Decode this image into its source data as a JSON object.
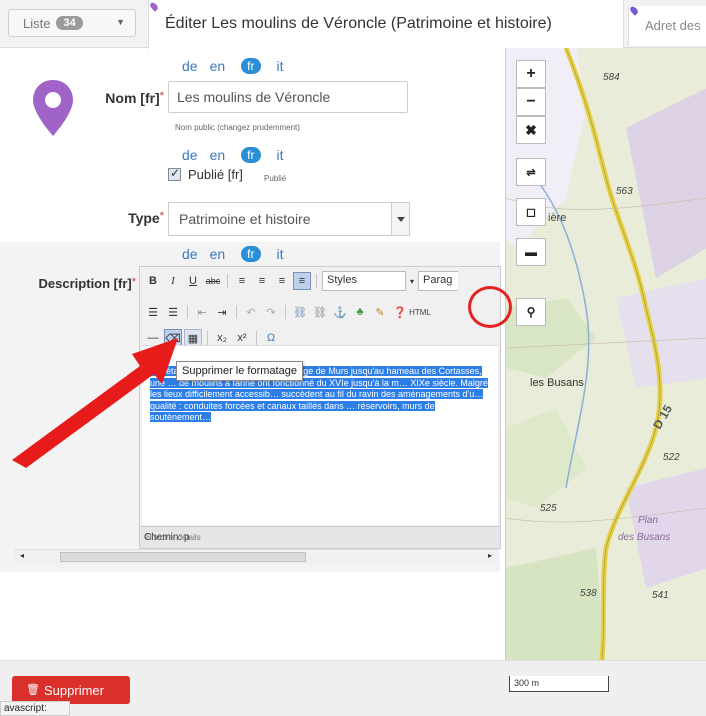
{
  "tabs": {
    "list_label": "Liste",
    "list_count": "34",
    "active_title": "Éditer Les moulins de Véroncle (Patrimoine et histoire)",
    "other_title": "Adret des"
  },
  "languages": [
    "de",
    "en",
    "fr",
    "it"
  ],
  "form": {
    "name_label": "Nom [fr]",
    "name_value": "Les moulins de Véroncle",
    "name_hint": "Nom public (changez prudemment)",
    "published_label": "Publié [fr]",
    "published_hint": "Publié",
    "type_label": "Type",
    "type_value": "Patrimoine et histoire",
    "description_label": "Description [fr]",
    "required_mark": "*"
  },
  "editor": {
    "styles_label": "Styles",
    "paragraph_label": "Parag",
    "tooltip": "Supprimer le formatage",
    "path_label": "Chemin: p",
    "selected_text": "…s étangs (aujourd'hui comb… le village de Murs jusqu'au hameau des Cortasses, une … de moulins à farine ont fonctionné du XVIe jusqu'à la m… XIXe siècle. Malgré les lieux difficilement accessib… succèdent au fil du ravin des aménagements d'u… qualité : conduites forcées et canaux taillés dans … réservoirs, murs de soutènement…"
  },
  "bottom_hint": "Histoire, détails",
  "map": {
    "labels": [
      "584",
      "563",
      "ière",
      "les Busans",
      "D 15",
      "522",
      "525",
      "Plan",
      "des Busans",
      "538",
      "541"
    ],
    "scale": "300 m"
  },
  "footer": {
    "delete_label": "Supprimer",
    "status_text": "avascript:"
  },
  "colors": {
    "accent": "#2b8fd6",
    "pin": "#a064c8",
    "delete": "#d9302c",
    "annotation": "#e52222",
    "selection": "#2e7ee8"
  }
}
